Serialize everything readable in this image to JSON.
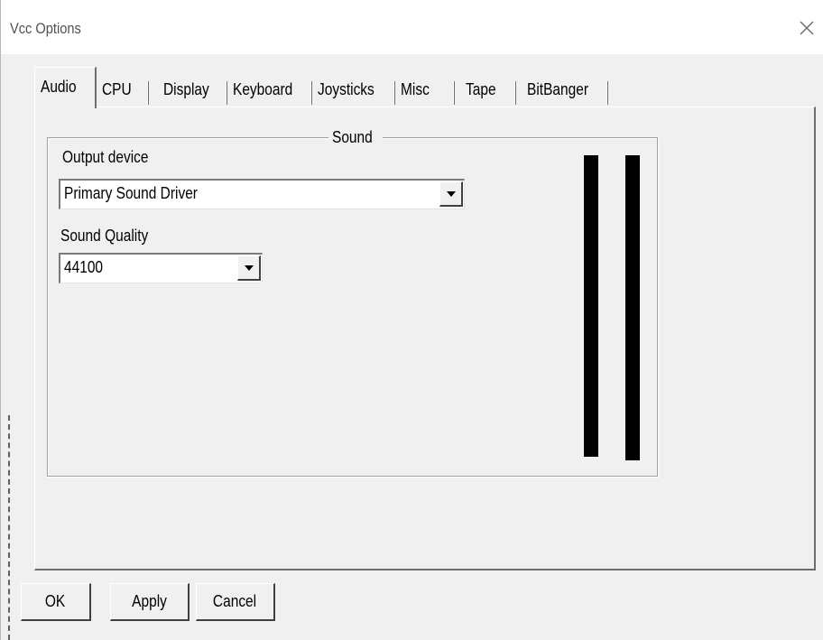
{
  "window": {
    "title": "Vcc Options",
    "close_glyph": "close-icon"
  },
  "tabs": [
    {
      "label": "Audio",
      "active": true
    },
    {
      "label": "CPU",
      "active": false
    },
    {
      "label": "Display",
      "active": false
    },
    {
      "label": "Keyboard",
      "active": false
    },
    {
      "label": "Joysticks",
      "active": false
    },
    {
      "label": "Misc",
      "active": false
    },
    {
      "label": "Tape",
      "active": false
    },
    {
      "label": "BitBanger",
      "active": false
    }
  ],
  "sound_group": {
    "title": "Sound",
    "output_device_label": "Output device",
    "output_device_value": "Primary Sound Driver",
    "sound_quality_label": "Sound Quality",
    "sound_quality_value": "44100"
  },
  "buttons": {
    "ok": "OK",
    "apply": "Apply",
    "cancel": "Cancel"
  },
  "colors": {
    "face": "#f0f0f0",
    "titlebar": "#ffffff",
    "meter": "#000000"
  }
}
